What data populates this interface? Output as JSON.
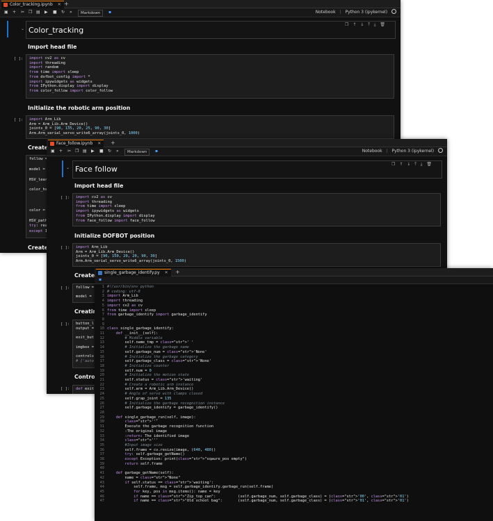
{
  "toolbar": {
    "cell_type": "Markdown",
    "notebook_label": "Notebook",
    "kernel": "Python 3 (ipykernel)"
  },
  "win1": {
    "tab": "Color_tracking.ipynb",
    "title": "Color_tracking",
    "h_import": "Import head file",
    "prompt_import": "[ ]:",
    "code_import": [
      "import cv2 as cv",
      "import threading",
      "import random",
      "from time import sleep",
      "from dofbot_config import *",
      "import ipywidgets as widgets",
      "from IPython.display import display",
      "from color_follow import color_follow"
    ],
    "h_init": "Initialize the robotic arm position",
    "prompt_init": "[ ]:",
    "code_init": [
      "import Arm_Lib",
      "Arm = Arm_Lib.Arm_Device()",
      "joints_0 = [90, 135, 20, 25, 90, 30]",
      "Arm.Arm_serial_servo_write6_array(joints_0, 1000)"
    ],
    "h_create": "Create",
    "partial_lines": [
      "follow =",
      "",
      "model =",
      "",
      "HSV_learn",
      "",
      "color_hsv",
      "",
      "",
      "",
      "color =",
      "",
      "HSV_path",
      "try: read",
      "except I"
    ],
    "h_create2": "Create"
  },
  "win2": {
    "tab": "Face_follow.ipynb",
    "title": "Face follow",
    "h_import": "Import head file",
    "prompt_import": "[ ]:",
    "code_import": [
      "import cv2 as cv",
      "import threading",
      "from time import sleep",
      "import ipywidgets as widgets",
      "from IPython.display import display",
      "from face_follow import face_follow"
    ],
    "h_init": "Initialize DOFBOT position",
    "prompt_init": "[ ]:",
    "code_init": [
      "import Arm_Lib",
      "Arm = Arm_Lib.Arm_Device()",
      "joints_0 = [90, 150, 20, 20, 90, 30]",
      "Arm.Arm_serial_servo_write6_array(joints_0, 1500)"
    ],
    "h_create": "Create",
    "prompt_create": "[ ]:",
    "partial_create": [
      "follow =",
      "",
      "model ="
    ],
    "h_creating": "Creatin",
    "prompt_creating": "[ ]:",
    "partial_creating": [
      "button_l",
      "output =",
      "",
      "exit_but",
      "",
      "imgbox =",
      "",
      "controls",
      "# ['auto"
    ],
    "h_control": "Contro",
    "prompt_control": "[ ]:",
    "partial_control": [
      "def exit"
    ]
  },
  "win3": {
    "tab": "single_garbage_identify.py",
    "line_numbers": [
      "1",
      "2",
      "3",
      "4",
      "5",
      "6",
      "7",
      "8",
      "9",
      "10",
      "11",
      "12",
      "13",
      "14",
      "15",
      "16",
      "17",
      "18",
      "19",
      "20",
      "21",
      "22",
      "23",
      "24",
      "25",
      "26",
      "27",
      "28",
      "29",
      "30",
      "31",
      "32",
      "33",
      "34",
      "35",
      "36",
      "37",
      "38",
      "39",
      "40",
      "41",
      "42",
      "43",
      "44",
      "45",
      "46",
      "47"
    ],
    "lines": [
      "#!/usr/bin/env python",
      "# coding: utf-8",
      "import Arm_Lib",
      "import threading",
      "import cv2 as cv",
      "from time import sleep",
      "from garbage_identify import garbage_identify",
      "",
      "",
      "class single_garbage_identify:",
      "    def __init__(self):",
      "        # Middle variable",
      "        self.name_tmp = ' '",
      "        # Initialize the garbage name",
      "        self.garbage_num = 'None'",
      "        # Initialize the garbage category",
      "        self.garbage_class = 'None'",
      "        # Initialize counter",
      "        self.num = 0",
      "        # Initialize the motion state",
      "        self.status = 'waiting'",
      "        # Create a robotic arm instance",
      "        self.arm = Arm_Lib.Arm_Device()",
      "        # Angle of servo with clamps closed",
      "        self.grap_joint = 135",
      "        # Initialize the garbage recognition instance",
      "        self.garbage_identify = garbage_identify()",
      "",
      "    def single_garbage_run(self, image):",
      "        '''",
      "        Execute the garbage recognition function",
      "        :The original image",
      "        :return: The identified image",
      "        '''",
      "        #Input image size",
      "        self.frame = cv.resize(image, (640, 480))",
      "        try: self.garbage_getName()",
      "        except Exception: print(\"sqaure_pos empty\")",
      "        return self.frame",
      "",
      "    def garbage_getName(self):",
      "        name = \"None\"",
      "        if self.status == 'waiting':",
      "            self.frame, msg = self.garbage_identify.garbage_run(self.frame)",
      "            for key, pos in msg.items(): name = key",
      "            if name == \"Zip_top_can\":          (self.garbage_num, self.garbage_class) = ('00', '01')",
      "            if name == \"Old school bag\":       (self.garbage_num, self.garbage_class) = ('01', '01')"
    ]
  }
}
